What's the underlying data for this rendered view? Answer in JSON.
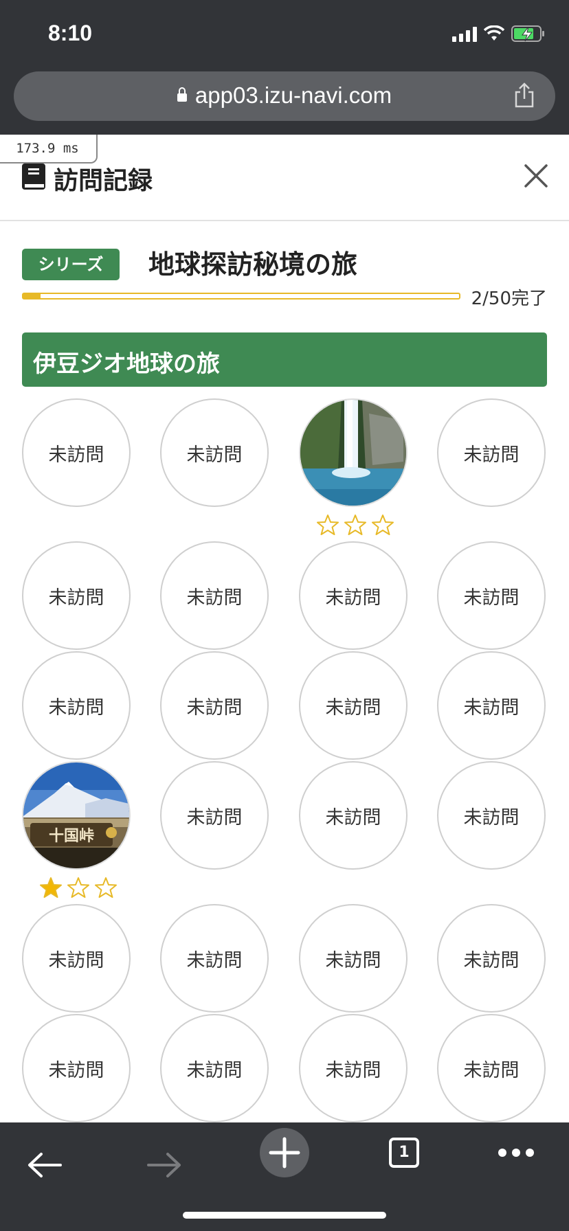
{
  "status_bar": {
    "time": "8:10"
  },
  "browser": {
    "url": "app03.izu-navi.com"
  },
  "perf_overlay": "173.9 ms",
  "header": {
    "title": "訪問記録"
  },
  "series": {
    "badge": "シリーズ",
    "title": "地球探訪秘境の旅",
    "progress_text": "2/50完了",
    "progress_fraction": 0.04
  },
  "group": {
    "title": "伊豆ジオ地球の旅"
  },
  "spots": [
    {
      "visited": false,
      "label": "未訪問"
    },
    {
      "visited": false,
      "label": "未訪問"
    },
    {
      "visited": true,
      "image": "waterfall-photo",
      "stars": 0
    },
    {
      "visited": false,
      "label": "未訪問"
    },
    {
      "visited": false,
      "label": "未訪問"
    },
    {
      "visited": false,
      "label": "未訪問"
    },
    {
      "visited": false,
      "label": "未訪問"
    },
    {
      "visited": false,
      "label": "未訪問"
    },
    {
      "visited": false,
      "label": "未訪問"
    },
    {
      "visited": false,
      "label": "未訪問"
    },
    {
      "visited": false,
      "label": "未訪問"
    },
    {
      "visited": false,
      "label": "未訪問"
    },
    {
      "visited": true,
      "image": "mount-fuji-signpost-photo",
      "sign_text": "十国峠",
      "stars": 1
    },
    {
      "visited": false,
      "label": "未訪問"
    },
    {
      "visited": false,
      "label": "未訪問"
    },
    {
      "visited": false,
      "label": "未訪問"
    },
    {
      "visited": false,
      "label": "未訪問"
    },
    {
      "visited": false,
      "label": "未訪問"
    },
    {
      "visited": false,
      "label": "未訪問"
    },
    {
      "visited": false,
      "label": "未訪問"
    },
    {
      "visited": false,
      "label": "未訪問"
    },
    {
      "visited": false,
      "label": "未訪問"
    },
    {
      "visited": false,
      "label": "未訪問"
    },
    {
      "visited": false,
      "label": "未訪問"
    }
  ],
  "toolbar": {
    "tab_count": "1"
  },
  "colors": {
    "green": "#3f8a53",
    "gold": "#e7b927",
    "chrome": "#323438"
  }
}
